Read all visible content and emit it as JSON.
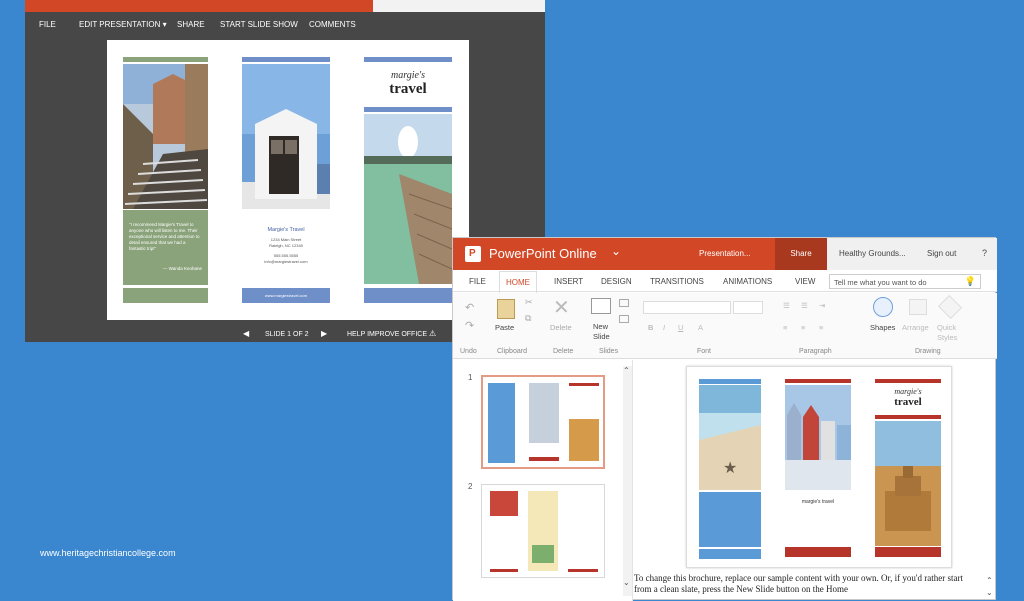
{
  "back_window": {
    "menu": [
      "FILE",
      "EDIT PRESENTATION ▾",
      "SHARE",
      "START SLIDE SHOW",
      "COMMENTS"
    ],
    "slide": {
      "brand_line1": "margie's",
      "brand_line2": "travel",
      "quote": "\"I recommend Margie's Travel to anyone who will listen to me. Their exceptional service and attention to detail ensured that we had a fantastic trip!\"",
      "quote_author": "— Wanda Keohane",
      "company": "Margie's Travel",
      "address1": "1234 Main Street",
      "address2": "Raleigh, NC 12345",
      "phone": "555.555.5555",
      "email": "info@margiestravel.com",
      "web": "www.margiestravel.com"
    },
    "status": {
      "slide_of": "SLIDE 1 OF 2",
      "help": "HELP IMPROVE OFFICE"
    }
  },
  "front_window": {
    "app_name": "PowerPoint Online",
    "doc_name": "Presentation...",
    "share": "Share",
    "user": "Healthy Grounds...",
    "sign_out": "Sign out",
    "help_icon": "?",
    "tabs": [
      "FILE",
      "HOME",
      "INSERT",
      "DESIGN",
      "TRANSITIONS",
      "ANIMATIONS",
      "VIEW"
    ],
    "tell_me": "Tell me what you want to do",
    "ribbon": {
      "paste": "Paste",
      "delete": "Delete",
      "new_slide_1": "New",
      "new_slide_2": "Slide",
      "shapes": "Shapes",
      "arrange": "Arrange",
      "quick_styles_1": "Quick",
      "quick_styles_2": "Styles",
      "groups": [
        "Undo",
        "Clipboard",
        "Delete",
        "Slides",
        "Font",
        "Paragraph",
        "Drawing"
      ]
    },
    "thumbnails": [
      "1",
      "2"
    ],
    "slide": {
      "brand_line1": "margie's",
      "brand_line2": "travel",
      "company": "margie's travel"
    },
    "notes": "To change this brochure, replace our sample content with your own. Or, if you'd rather start from a clean slate, press the New Slide button on the Home"
  },
  "watermark": "www.heritagechristiancollege.com",
  "colors": {
    "desktop": "#3a87cf",
    "ppt_orange": "#d24726",
    "green_panel": "#8aa37a",
    "blue_panel": "#6f8fc9",
    "red_panel": "#b7342b",
    "light_blue_panel": "#5a9ad6"
  }
}
